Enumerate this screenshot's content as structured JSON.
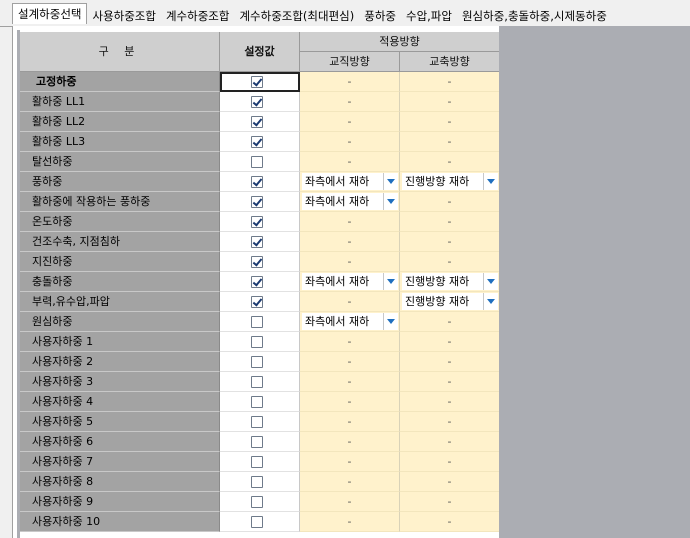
{
  "tabs": [
    {
      "label": "설계하중선택",
      "active": true
    },
    {
      "label": "사용하중조합",
      "active": false
    },
    {
      "label": "계수하중조합",
      "active": false
    },
    {
      "label": "계수하중조합(최대편심)",
      "active": false
    },
    {
      "label": "풍하중",
      "active": false
    },
    {
      "label": "수압,파압",
      "active": false
    },
    {
      "label": "원심하중,충돌하중,시제동하중",
      "active": false
    }
  ],
  "grid": {
    "header": {
      "gubun": "구 분",
      "setting": "설정값",
      "apply_direction": "적용방향",
      "perpendicular": "교직방향",
      "axial": "교축방향"
    },
    "rows": [
      {
        "name": "고정하중",
        "bold": true,
        "checked": true,
        "focus": true,
        "d1": "-",
        "d2": "-"
      },
      {
        "name": "활하중  LL1",
        "checked": true,
        "d1": "-",
        "d2": "-"
      },
      {
        "name": "활하중  LL2",
        "checked": true,
        "d1": "-",
        "d2": "-"
      },
      {
        "name": "활하중  LL3",
        "checked": true,
        "d1": "-",
        "d2": "-"
      },
      {
        "name": "탈선하중",
        "checked": false,
        "d1": "-",
        "d2": "-"
      },
      {
        "name": "풍하중",
        "checked": true,
        "d1_dropdown": "좌측에서 재하",
        "d2_dropdown": "진행방향 재하"
      },
      {
        "name": "활하중에 작용하는 풍하중",
        "checked": true,
        "d1_dropdown": "좌측에서 재하",
        "d2": "-"
      },
      {
        "name": "온도하중",
        "checked": true,
        "d1": "-",
        "d2": "-"
      },
      {
        "name": "건조수축, 지점침하",
        "checked": true,
        "d1": "-",
        "d2": "-"
      },
      {
        "name": "지진하중",
        "checked": true,
        "d1": "-",
        "d2": "-"
      },
      {
        "name": "충돌하중",
        "checked": true,
        "d1_dropdown": "좌측에서 재하",
        "d2_dropdown": "진행방향 재하"
      },
      {
        "name": "부력,유수압,파압",
        "checked": true,
        "d1": "-",
        "d2_dropdown": "진행방향 재하"
      },
      {
        "name": "원심하중",
        "checked": false,
        "d1_dropdown": "좌측에서 재하",
        "d2": "-"
      },
      {
        "name": "사용자하중 1",
        "checked": false,
        "d1": "-",
        "d2": "-"
      },
      {
        "name": "사용자하중 2",
        "checked": false,
        "d1": "-",
        "d2": "-"
      },
      {
        "name": "사용자하중 3",
        "checked": false,
        "d1": "-",
        "d2": "-"
      },
      {
        "name": "사용자하중 4",
        "checked": false,
        "d1": "-",
        "d2": "-"
      },
      {
        "name": "사용자하중 5",
        "checked": false,
        "d1": "-",
        "d2": "-"
      },
      {
        "name": "사용자하중 6",
        "checked": false,
        "d1": "-",
        "d2": "-"
      },
      {
        "name": "사용자하중 7",
        "checked": false,
        "d1": "-",
        "d2": "-"
      },
      {
        "name": "사용자하중 8",
        "checked": false,
        "d1": "-",
        "d2": "-"
      },
      {
        "name": "사용자하중 9",
        "checked": false,
        "d1": "-",
        "d2": "-"
      },
      {
        "name": "사용자하중 10",
        "checked": false,
        "d1": "-",
        "d2": "-"
      }
    ]
  },
  "colors": {
    "name_cell_bg": "#a3a3a3",
    "data_cell_bg": "#fff2cc",
    "header_bg": "#cfcfcf",
    "dropdown_arrow": "#1f6fbf"
  }
}
